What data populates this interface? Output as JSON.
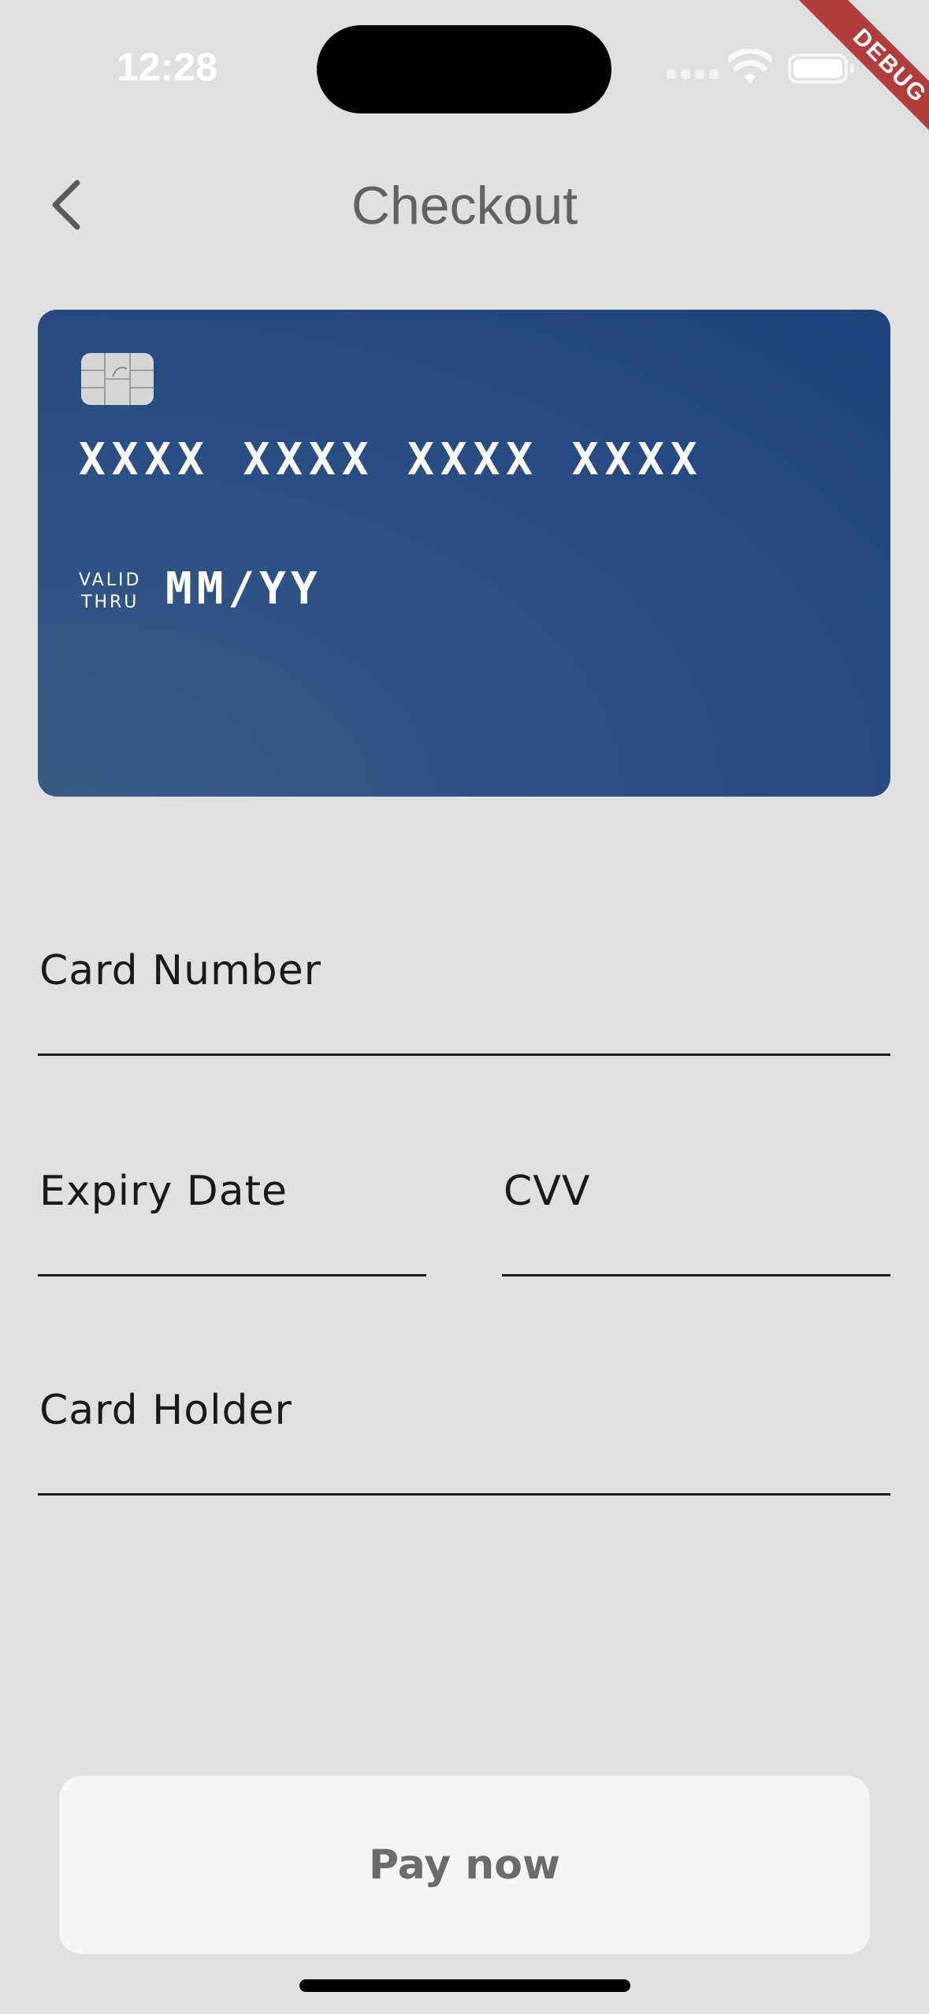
{
  "status_bar": {
    "time": "12:28"
  },
  "debug_banner": "DEBUG",
  "header": {
    "title": "Checkout",
    "back_icon": "chevron-left-icon"
  },
  "card": {
    "number": "XXXX XXXX XXXX XXXX",
    "valid_thru_line1": "VALID",
    "valid_thru_line2": "THRU",
    "expiry": "MM/YY",
    "gradient_colors": [
      "#3b5b86",
      "#1d447c"
    ]
  },
  "form": {
    "card_number_label": "Card Number",
    "expiry_label": "Expiry Date",
    "cvv_label": "CVV",
    "holder_label": "Card Holder"
  },
  "pay_button": {
    "label": "Pay now"
  }
}
